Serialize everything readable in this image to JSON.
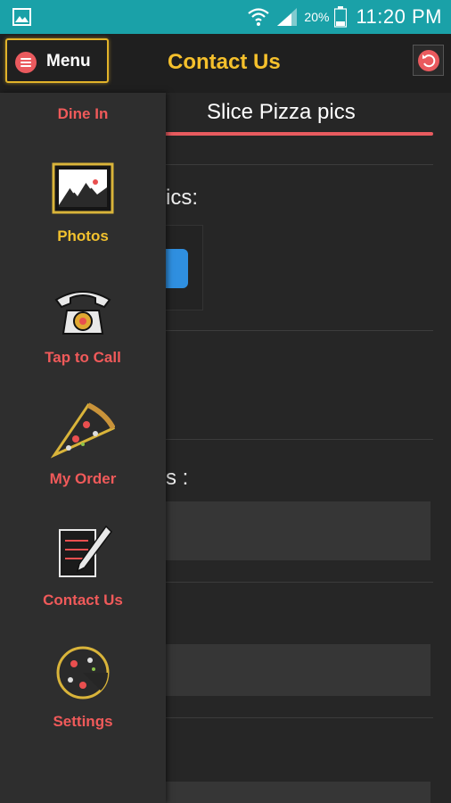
{
  "status_bar": {
    "battery_percent": "20%",
    "time": "11:20 PM",
    "icons": [
      "gallery-notification-icon",
      "wifi-icon",
      "signal-icon",
      "battery-icon"
    ]
  },
  "app_bar": {
    "menu_label": "Menu",
    "title": "Contact Us",
    "icons": [
      "hamburger-icon",
      "refresh-icon"
    ]
  },
  "content": {
    "tab_title": "Slice Pizza pics",
    "upload_label_partial": "ics:",
    "field_label_partial": "s :"
  },
  "drawer": {
    "items": [
      {
        "label": "Dine In",
        "icon": "",
        "color": "#f05a5a"
      },
      {
        "label": "Photos",
        "icon": "photo-frame-icon",
        "color": "#f2c12e"
      },
      {
        "label": "Tap to Call",
        "icon": "telephone-icon",
        "color": "#f05a5a"
      },
      {
        "label": "My Order",
        "icon": "pizza-slice-icon",
        "color": "#f05a5a"
      },
      {
        "label": "Contact Us",
        "icon": "notepad-pencil-icon",
        "color": "#f05a5a"
      },
      {
        "label": "Settings",
        "icon": "pizza-gear-icon",
        "color": "#f05a5a"
      }
    ]
  },
  "colors": {
    "status_bar": "#1aa1a8",
    "accent_red": "#f05a5a",
    "accent_gold": "#f2c12e",
    "upload_blue": "#2f8fe0"
  }
}
